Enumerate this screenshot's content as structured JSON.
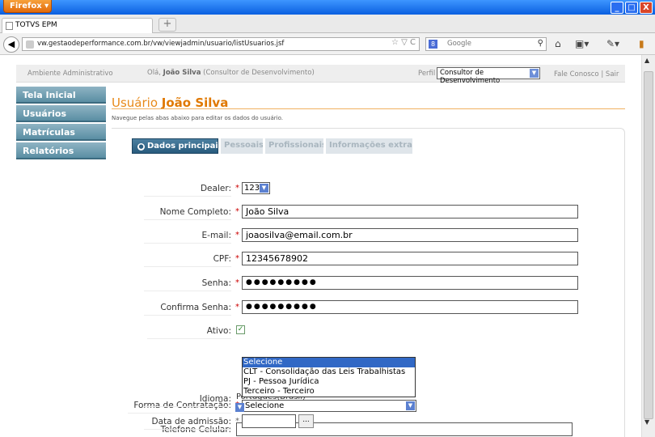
{
  "browser": {
    "menu_button": "Firefox",
    "tab_title": "TOTVS EPM",
    "new_tab": "+",
    "url": "vw.gestaodeperformance.com.br/vw/viewjadmin/usuario/listUsuarios.jsf",
    "search_placeholder": "Google",
    "win_min": "_",
    "win_max": "□",
    "win_close": "X"
  },
  "header": {
    "area_label": "Ambiente Administrativo",
    "greeting": "Olá,",
    "user_name": "João Silva",
    "user_role": "(Consultor de Desenvolvimento)",
    "profile_label": "Perfil",
    "profile_value": "Consultor de Desenvolvimento",
    "contact_link": "Fale Conosco",
    "separator": "|",
    "exit_link": "Sair"
  },
  "sidebar": {
    "items": [
      {
        "label": "Tela Inicial"
      },
      {
        "label": "Usuários"
      },
      {
        "label": "Matrículas"
      },
      {
        "label": "Relatórios"
      }
    ]
  },
  "main": {
    "title_prefix": "Usuário",
    "title_name": "João Silva",
    "subtitle": "Navegue pelas abas abaixo para editar os dados do usuário.",
    "tabs": [
      {
        "label": "Dados principais",
        "active": true
      },
      {
        "label": "Pessoais",
        "active": false
      },
      {
        "label": "Profissionais",
        "active": false
      },
      {
        "label": "Informações extras",
        "active": false
      }
    ]
  },
  "form": {
    "dealer_label": "Dealer:",
    "dealer_value": "123",
    "nome_label": "Nome Completo:",
    "nome_value": "João Silva",
    "email_label": "E-mail:",
    "email_value": "joaosilva@email.com.br",
    "cpf_label": "CPF:",
    "cpf_value": "12345678902",
    "senha_label": "Senha:",
    "senha_value": "●●●●●●●●●",
    "confirma_label": "Confirma Senha:",
    "confirma_value": "●●●●●●●●●",
    "ativo_label": "Ativo:",
    "ativo_checked": true,
    "contratacao_label": "Forma de Contratação:",
    "contratacao_value": "Selecione",
    "contratacao_options": [
      "Selecione",
      "CLT - Consolidação das Leis Trabalhistas",
      "PJ - Pessoa Jurídica",
      "Terceiro - Terceiro"
    ],
    "telefone_label": "Telefone Celular:",
    "idioma_label": "Idioma:",
    "idioma_value": "Português(Brasil)",
    "admissao_label": "Data de admissão:",
    "date_button": "...",
    "required_mark": "*"
  },
  "colors": {
    "accent_orange": "#e07800",
    "sidebar_blue": "#5a8ea3",
    "active_tab": "#285b7d",
    "required_red": "#cc0000"
  }
}
